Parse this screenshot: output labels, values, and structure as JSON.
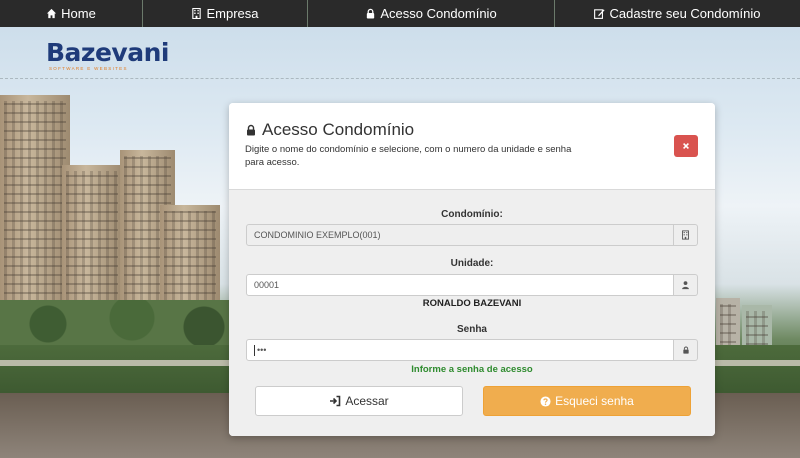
{
  "nav": {
    "items": [
      {
        "label": "Home",
        "icon": "home-icon"
      },
      {
        "label": "Empresa",
        "icon": "building-icon"
      },
      {
        "label": "Acesso Condomínio",
        "icon": "lock-icon"
      },
      {
        "label": "Cadastre seu Condomínio",
        "icon": "edit-icon"
      }
    ]
  },
  "logo": {
    "text": "Bazevani",
    "tagline": "SOFTWARE E WEBSITES"
  },
  "modal": {
    "title": "Acesso Condomínio",
    "description": "Digite o nome do condomínio e selecione, com o numero da unidade e senha para acesso.",
    "close_icon": "times-icon",
    "condominio_label": "Condomínio:",
    "condominio_value": "CONDOMINIO EXEMPLO(001)",
    "unidade_label": "Unidade:",
    "unidade_value": "00001",
    "owner_name": "RONALDO BAZEVANI",
    "senha_label": "Senha",
    "senha_value": "•••",
    "senha_hint": "Informe a senha de acesso",
    "acessar_label": "Acessar",
    "esqueci_label": "Esqueci senha"
  },
  "colors": {
    "navbar": "#2a2a2a",
    "close_button": "#d9534f",
    "warning_button": "#f0ad4e",
    "hint_text": "#2e8b2e",
    "logo_primary": "#1f3b7a",
    "logo_accent": "#e37b20"
  }
}
